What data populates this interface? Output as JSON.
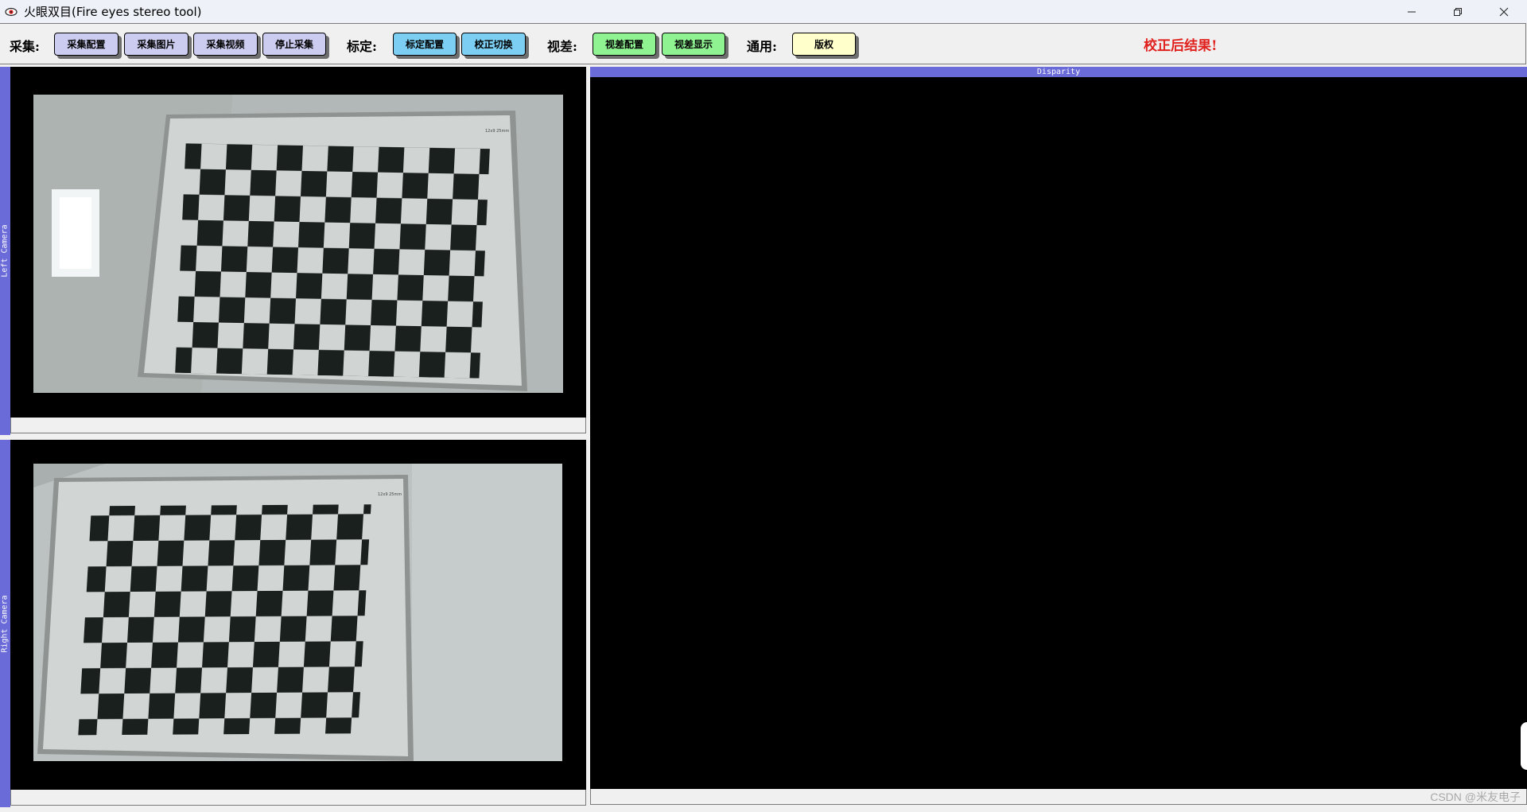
{
  "window": {
    "title": "火眼双目(Fire eyes stereo tool)",
    "icons": [
      "app-eye-icon",
      "minimize-icon",
      "restore-icon",
      "close-icon"
    ]
  },
  "toolbar": {
    "capture_label": "采集:",
    "capture_config": "采集配置",
    "capture_image": "采集图片",
    "capture_video": "采集视频",
    "stop_capture": "停止采集",
    "calib_label": "标定:",
    "calib_config": "标定配置",
    "rectify_switch": "校正切换",
    "disparity_label": "视差:",
    "disparity_config": "视差配置",
    "disparity_show": "视差显示",
    "general_label": "通用:",
    "copyright": "版权",
    "status": "校正后结果!",
    "colors": {
      "capture_buttons": "#ccccf0",
      "calib_buttons": "#7ccff2",
      "disparity_buttons": "#8ff391",
      "general_buttons": "#ffffcc",
      "status_text": "#e0201c",
      "panel_header": "#6a6ad8"
    }
  },
  "panels": {
    "left_camera": "Left Camera",
    "right_camera": "Right Camera",
    "disparity": "Disparity"
  },
  "watermark": "CSDN @米友电子"
}
